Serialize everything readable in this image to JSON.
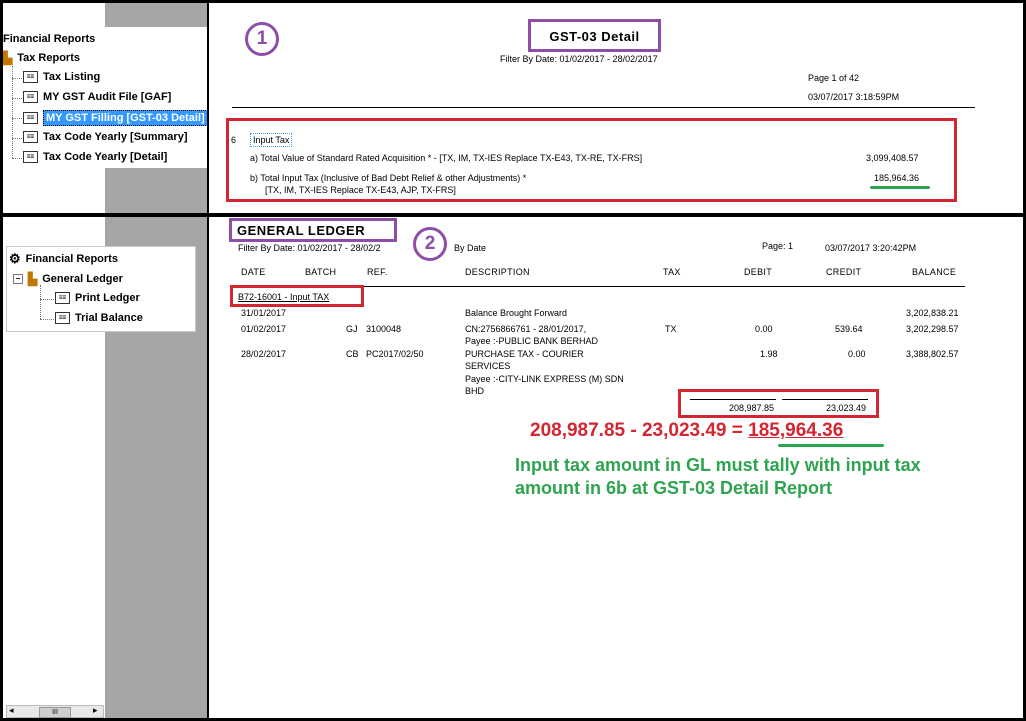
{
  "top_tree": {
    "root": "Financial Reports",
    "group": "Tax Reports",
    "items": [
      {
        "label": "Tax Listing"
      },
      {
        "label": "MY GST Audit File [GAF]"
      },
      {
        "label": "MY GST Filling [GST-03 Detail]",
        "selected": true
      },
      {
        "label": "Tax Code Yearly [Summary]"
      },
      {
        "label": "Tax Code Yearly [Detail]"
      }
    ]
  },
  "bottom_tree": {
    "root": "Financial Reports",
    "group": "General Ledger",
    "items": [
      {
        "label": "Print Ledger"
      },
      {
        "label": "Trial Balance"
      }
    ]
  },
  "gst_report": {
    "marker": "1",
    "title": "GST-03 Detail",
    "filter": "Filter By Date: 01/02/2017 - 28/02/2017",
    "page": "Page 1 of 42",
    "timestamp": "03/07/2017  3:18:59PM",
    "section_no": "6",
    "section_label": "Input Tax",
    "line_a": "a) Total Value of Standard Rated Acquisition * -  [TX, IM, TX-IES Replace TX-E43, TX-RE, TX-FRS]",
    "line_a_value": "3,099,408.57",
    "line_b1": "b) Total Input Tax (Inclusive of Bad Debt Relief & other Adjustments) *",
    "line_b2": "[TX, IM, TX-IES Replace TX-E43, AJP, TX-FRS]",
    "line_b_value": "185,964.36"
  },
  "gl_report": {
    "marker": "2",
    "title": "GENERAL LEDGER",
    "filter": "Filter By Date: 01/02/2017 - 28/02/2",
    "by_date": "By Date",
    "page": "Page: 1",
    "timestamp": "03/07/2017 3:20:42PM",
    "columns": [
      "DATE",
      "BATCH",
      "REF.",
      "DESCRIPTION",
      "TAX",
      "DEBIT",
      "CREDIT",
      "BALANCE"
    ],
    "account": "B72-16001 - Input TAX",
    "rows": [
      {
        "date": "31/01/2017",
        "batch": "",
        "ref": "",
        "desc": "Balance Brought Forward",
        "desc2": "",
        "tax": "",
        "debit": "",
        "credit": "",
        "balance": "3,202,838.21"
      },
      {
        "date": "01/02/2017",
        "batch": "GJ",
        "ref": "3100048",
        "desc": "CN:2756866761 - 28/01/2017,",
        "desc2": "Payee :-PUBLIC BANK BERHAD",
        "tax": "TX",
        "debit": "0.00",
        "credit": "539.64",
        "balance": "3,202,298.57"
      },
      {
        "date": "28/02/2017",
        "batch": "CB",
        "ref": "PC2017/02/50",
        "desc": "PURCHASE TAX - COURIER",
        "desc2": "SERVICES",
        "desc3": "Payee :-CITY-LINK EXPRESS (M) SDN",
        "desc4": "BHD",
        "tax": "",
        "debit": "1.98",
        "credit": "0.00",
        "balance": "3,388,802.57"
      }
    ],
    "total_debit": "208,987.85",
    "total_credit": "23,023.49"
  },
  "annotation": {
    "equation_prefix": "208,987.85 - 23,023.49 = ",
    "equation_result": "185,964.36",
    "note_line1": "Input tax amount in GL must tally with input tax",
    "note_line2": "amount in 6b at GST-03 Detail Report",
    "red": "#d22630",
    "green": "#2ea44f",
    "purple": "#8e4ea8"
  },
  "scrollbar": {
    "thumb": "III"
  }
}
